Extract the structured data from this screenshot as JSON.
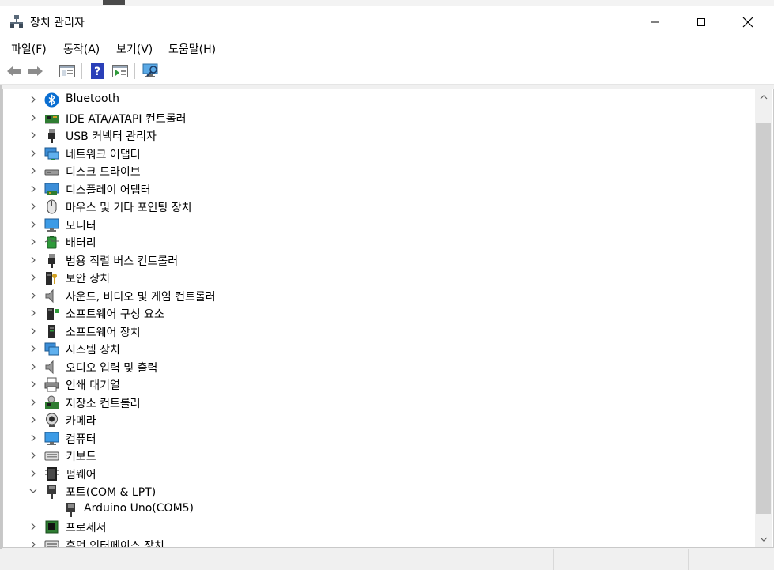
{
  "window": {
    "title": "장치 관리자",
    "title_icon": "device-manager-icon",
    "buttons": [
      "minimize-icon",
      "maximize-icon",
      "close-icon"
    ]
  },
  "menu": {
    "items": [
      {
        "label": "파일(F)"
      },
      {
        "label": "동작(A)"
      },
      {
        "label": "보기(V)"
      },
      {
        "label": "도움말(H)"
      }
    ]
  },
  "toolbar": {
    "buttons": [
      "back-arrow-icon",
      "forward-arrow-icon",
      "properties-pane-icon",
      "help-icon",
      "update-driver-icon",
      "scan-hardware-icon"
    ]
  },
  "tree": {
    "items": [
      {
        "label": "Bluetooth",
        "icon": "bluetooth-icon",
        "state": "collapsed"
      },
      {
        "label": "IDE ATA/ATAPI 컨트롤러",
        "icon": "ide-controller-icon",
        "state": "collapsed"
      },
      {
        "label": "USB 커넥터 관리자",
        "icon": "usb-connector-icon",
        "state": "collapsed"
      },
      {
        "label": "네트워크 어댑터",
        "icon": "network-adapter-icon",
        "state": "collapsed"
      },
      {
        "label": "디스크 드라이브",
        "icon": "disk-drive-icon",
        "state": "collapsed"
      },
      {
        "label": "디스플레이 어댑터",
        "icon": "display-adapter-icon",
        "state": "collapsed"
      },
      {
        "label": "마우스 및 기타 포인팅 장치",
        "icon": "mouse-icon",
        "state": "collapsed"
      },
      {
        "label": "모니터",
        "icon": "monitor-icon",
        "state": "collapsed"
      },
      {
        "label": "배터리",
        "icon": "battery-icon",
        "state": "collapsed"
      },
      {
        "label": "범용 직렬 버스 컨트롤러",
        "icon": "usb-controller-icon",
        "state": "collapsed"
      },
      {
        "label": "보안 장치",
        "icon": "security-device-icon",
        "state": "collapsed"
      },
      {
        "label": "사운드, 비디오 및 게임 컨트롤러",
        "icon": "speaker-icon",
        "state": "collapsed"
      },
      {
        "label": "소프트웨어 구성 요소",
        "icon": "software-component-icon",
        "state": "collapsed"
      },
      {
        "label": "소프트웨어 장치",
        "icon": "software-device-icon",
        "state": "collapsed"
      },
      {
        "label": "시스템 장치",
        "icon": "system-device-icon",
        "state": "collapsed"
      },
      {
        "label": "오디오 입력 및 출력",
        "icon": "audio-io-icon",
        "state": "collapsed"
      },
      {
        "label": "인쇄 대기열",
        "icon": "printer-icon",
        "state": "collapsed"
      },
      {
        "label": "저장소 컨트롤러",
        "icon": "storage-controller-icon",
        "state": "collapsed"
      },
      {
        "label": "카메라",
        "icon": "camera-icon",
        "state": "collapsed"
      },
      {
        "label": "컴퓨터",
        "icon": "computer-icon",
        "state": "collapsed"
      },
      {
        "label": "키보드",
        "icon": "keyboard-icon",
        "state": "collapsed"
      },
      {
        "label": "펌웨어",
        "icon": "firmware-icon",
        "state": "collapsed"
      },
      {
        "label": "포트(COM & LPT)",
        "icon": "port-icon",
        "state": "expanded",
        "children": [
          {
            "label": "Arduino Uno(COM5)",
            "icon": "port-device-icon"
          }
        ]
      },
      {
        "label": "프로세서",
        "icon": "processor-icon",
        "state": "collapsed"
      },
      {
        "label": "휴먼 인터페이스 장치",
        "icon": "hid-icon",
        "state": "collapsed"
      }
    ]
  },
  "colors": {
    "accent": "#0078d7",
    "scroll_thumb": "#cdcdcd",
    "chrome_bg": "#f0f0f0"
  }
}
